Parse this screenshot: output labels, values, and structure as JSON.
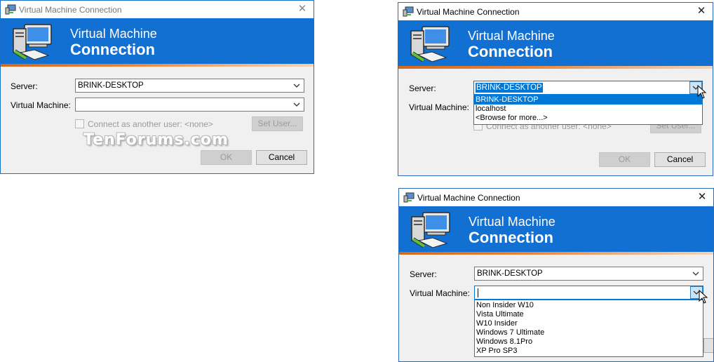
{
  "window": {
    "title": "Virtual Machine Connection"
  },
  "banner": {
    "line1": "Virtual Machine",
    "line2": "Connection"
  },
  "labels": {
    "server": "Server:",
    "virtual_machine": "Virtual Machine:"
  },
  "connect_as_label": "Connect as another user: <none>",
  "buttons": {
    "set_user": "Set User...",
    "ok": "OK",
    "cancel": "Cancel"
  },
  "watermark": "TenForums.com",
  "server_value": "BRINK-DESKTOP",
  "server_options": [
    "BRINK-DESKTOP",
    "localhost",
    "<Browse for more...>"
  ],
  "vm_options": [
    "Non Insider W10",
    "Vista Ultimate",
    "W10 Insider",
    "Windows 7 Ultimate",
    "Windows 8.1Pro",
    "XP Pro SP3"
  ],
  "colors": {
    "banner_blue": "#1370d3",
    "accent_orange": "#d2691e",
    "selection_blue": "#0078d7"
  },
  "icons": {
    "app": "vm-connection-icon",
    "close": "close-icon",
    "dropdown": "chevron-down-icon"
  }
}
